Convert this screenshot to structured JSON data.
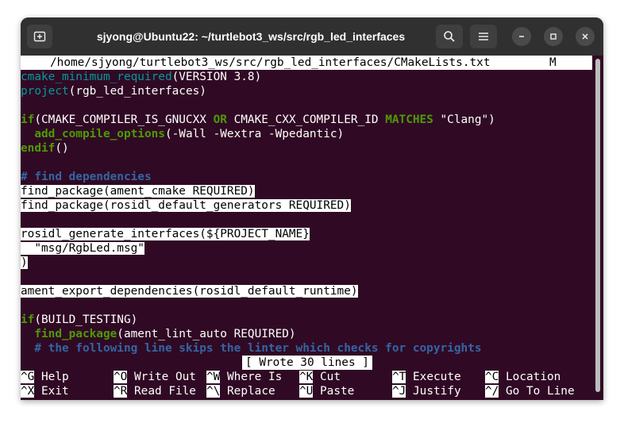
{
  "window": {
    "title": "sjyong@Ubuntu22: ~/turtlebot3_ws/src/rgb_led_interfaces"
  },
  "editor": {
    "header_path": "/home/sjyong/turtlebot3_ws/src/rgb_led_interfaces/CMakeLists.txt",
    "header_flag": "M",
    "lines": {
      "l1_fn": "cmake_minimum_required",
      "l1_rest": "(VERSION 3.8)",
      "l2_fn": "project",
      "l2_rest": "(rgb_led_interfaces)",
      "l4_if": "if",
      "l4_a": "(CMAKE_COMPILER_IS_GNUCXX ",
      "l4_or": "OR",
      "l4_b": " CMAKE_CXX_COMPILER_ID ",
      "l4_matches": "MATCHES",
      "l4_c": " \"Clang\")",
      "l5_fn": "  add_compile_options",
      "l5_rest": "(-Wall -Wextra -Wpedantic)",
      "l6_fn": "endif",
      "l6_rest": "()",
      "l8": "# find dependencies",
      "l9": "find_package(ament_cmake REQUIRED)",
      "l10": "find_package(rosidl_default_generators REQUIRED)",
      "l12": "rosidl_generate_interfaces(${PROJECT_NAME}",
      "l13": "  \"msg/RgbLed.msg\"",
      "l14": ")",
      "l16": "ament_export_dependencies(rosidl_default_runtime)",
      "l18_if": "if",
      "l18_rest": "(BUILD_TESTING)",
      "l19_fn": "  find_package",
      "l19_rest": "(ament_lint_auto REQUIRED)",
      "l20": "  # the following line skips the linter which checks for copyrights"
    },
    "status": "[ Wrote 30 lines ]"
  },
  "shortcuts": {
    "help_key": "^G",
    "help": "Help",
    "writeout_key": "^O",
    "writeout": "Write Out",
    "whereis_key": "^W",
    "whereis": "Where Is",
    "cut_key": "^K",
    "cut": "Cut",
    "execute_key": "^T",
    "execute": "Execute",
    "location_key": "^C",
    "location": "Location",
    "exit_key": "^X",
    "exit": "Exit",
    "readfile_key": "^R",
    "readfile": "Read File",
    "replace_key": "^\\",
    "replace": "Replace",
    "paste_key": "^U",
    "paste": "Paste",
    "justify_key": "^J",
    "justify": "Justify",
    "gotoline_key": "^/",
    "gotoline": "Go To Line"
  }
}
